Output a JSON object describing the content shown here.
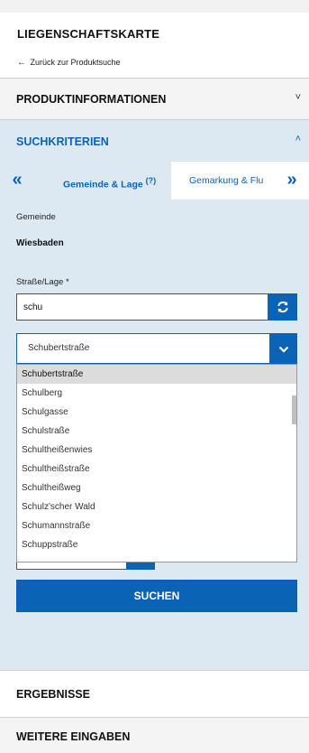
{
  "header": {
    "title": "LIEGENSCHAFTSKARTE",
    "back_arrow": "←",
    "back_label": "Zurück zur Produktsuche"
  },
  "sections": {
    "product_info": {
      "label": "PRODUKTINFORMATIONEN",
      "state": "collapsed",
      "chevron": "˅"
    },
    "criteria": {
      "label": "SUCHKRITERIEN",
      "state": "expanded",
      "chevron": "˄"
    },
    "results": {
      "label": "ERGEBNISSE"
    },
    "more": {
      "label": "WEITERE EINGABEN"
    }
  },
  "tabs": {
    "prev_symbol": "«",
    "next_symbol": "»",
    "items": [
      {
        "label": "Gemeinde & Lage",
        "help_symbol": "?",
        "active": true
      },
      {
        "label": "Gemarkung & Flu",
        "active": false
      }
    ]
  },
  "form": {
    "gemeinde_label": "Gemeinde",
    "gemeinde_value": "Wiesbaden",
    "strasse_label": "Straße/Lage",
    "strasse_required_mark": "*",
    "search_value": "schu",
    "selected_street": "Schubertstraße",
    "search_button": "SUCHEN"
  },
  "dropdown": {
    "options": [
      "Schubertstraße",
      "Schulberg",
      "Schulgasse",
      "Schulstraße",
      "Schultheißenwies",
      "Schultheißstraße",
      "Schultheißweg",
      "Schulz'scher Wald",
      "Schumannstraße",
      "Schuppstraße"
    ],
    "highlighted_index": 0
  },
  "colors": {
    "accent": "#0a63b5",
    "panel": "#dce9f3",
    "highlight": "#dcdcdc"
  },
  "icons": {
    "refresh": "refresh-icon",
    "dropdown": "chevron-down-icon",
    "back": "arrow-left-icon"
  }
}
